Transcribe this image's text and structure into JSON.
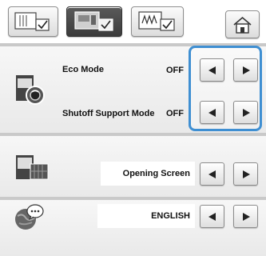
{
  "tabs": [
    {
      "name": "general-settings",
      "active": false
    },
    {
      "name": "embroidery-settings",
      "active": true
    },
    {
      "name": "display-settings",
      "active": false
    }
  ],
  "home_button": {
    "icon": "home-icon"
  },
  "settings": {
    "eco_mode": {
      "label": "Eco Mode",
      "value": "OFF"
    },
    "shutoff_support_mode": {
      "label": "Shutoff Support Mode",
      "value": "OFF"
    },
    "opening_screen": {
      "value": "Opening Screen"
    },
    "language": {
      "value": "ENGLISH"
    }
  },
  "colors": {
    "highlight": "#3f8fd2",
    "divider": "#c9c9c9"
  }
}
